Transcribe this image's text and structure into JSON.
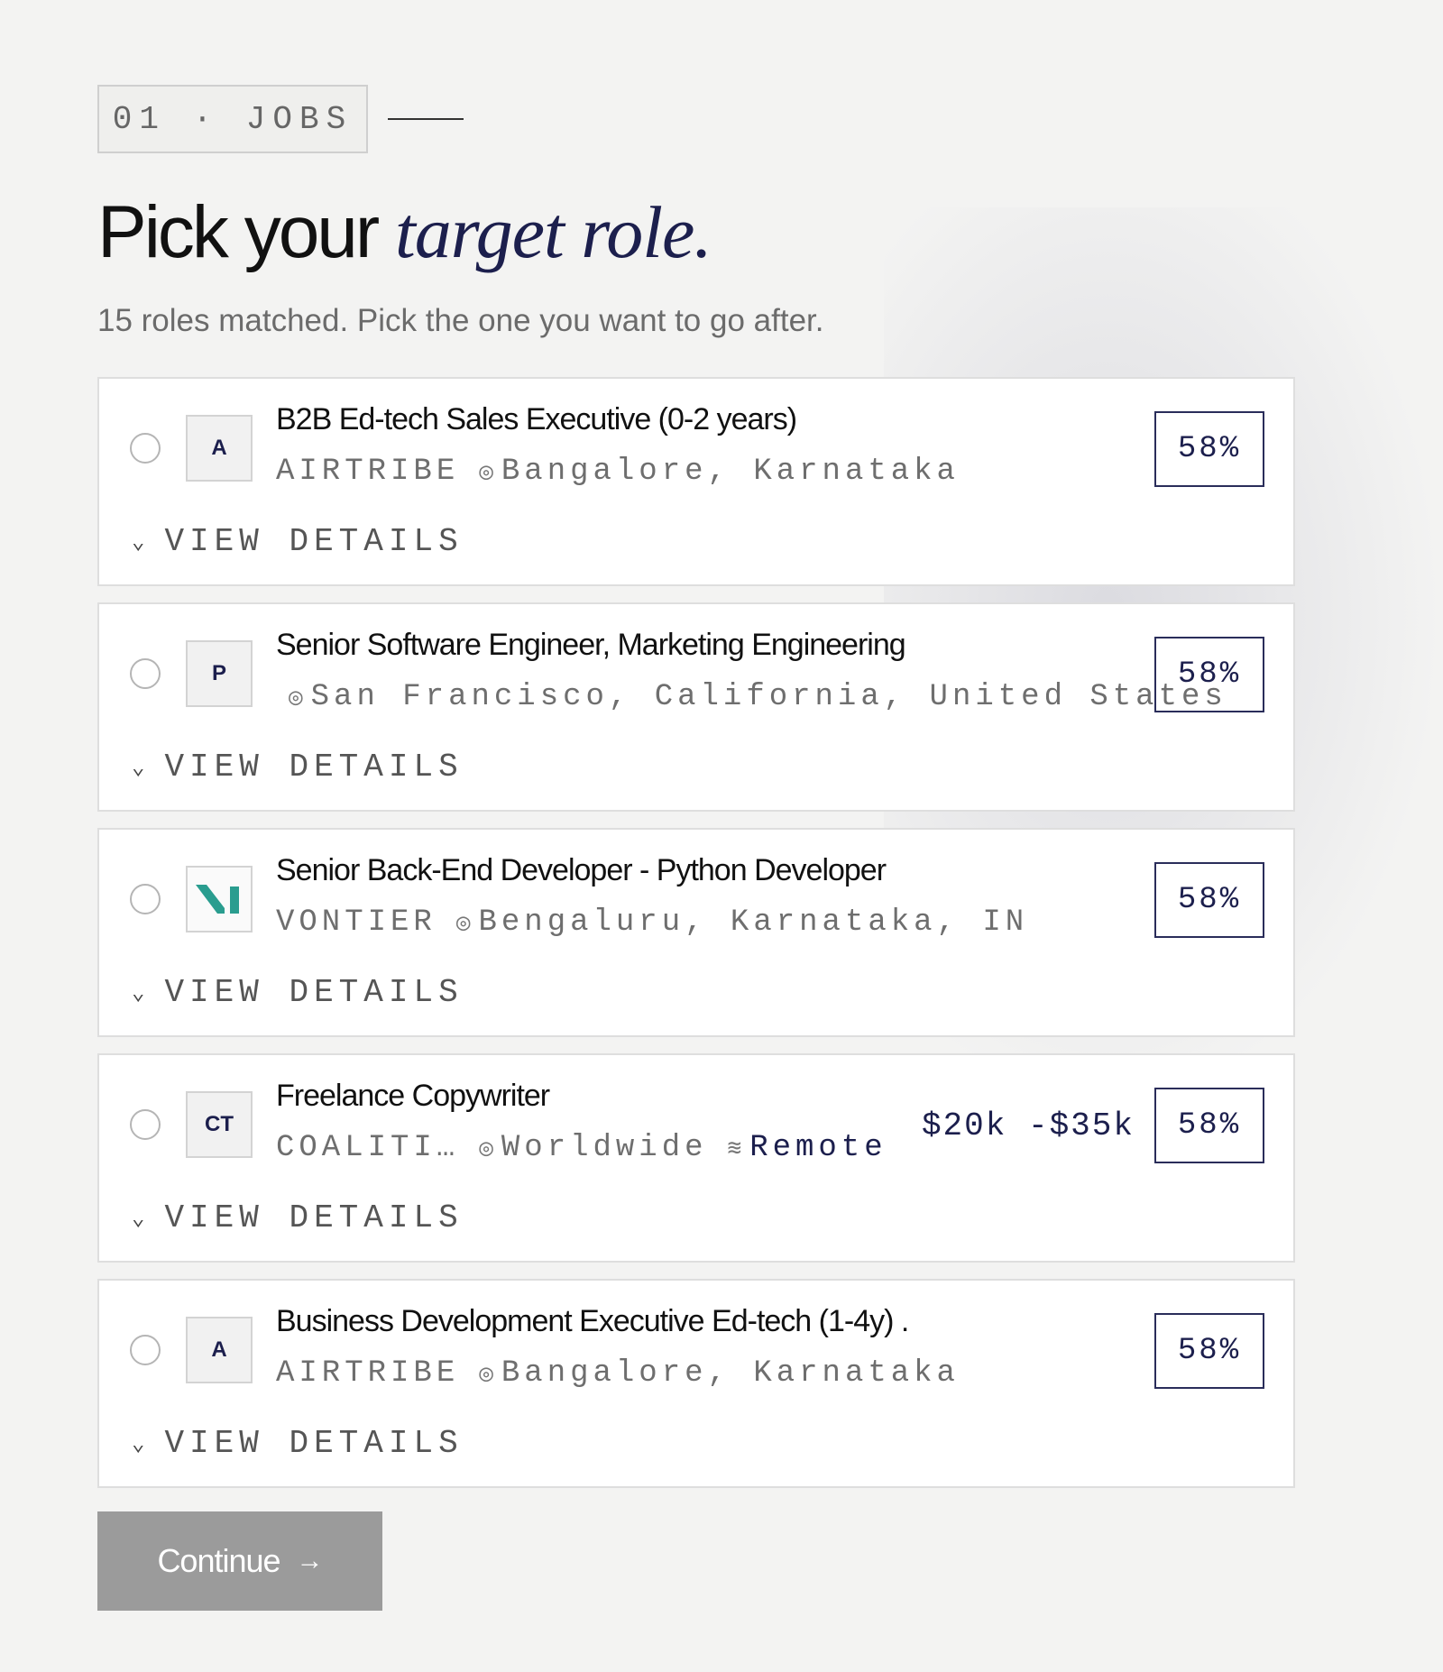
{
  "header": {
    "eyebrow": "01 · JOBS",
    "title_plain": "Pick your ",
    "title_accent": "target role.",
    "subtitle": "15 roles matched. Pick the one you want to go after."
  },
  "jobs": [
    {
      "logo": "A",
      "title": "B2B Ed-tech Sales Executive (0-2 years)",
      "company": "AIRTRIBE",
      "location": "Bangalore, Karnataka",
      "salary": "",
      "remote": "",
      "match": "58%",
      "details_label": "VIEW DETAILS"
    },
    {
      "logo": "P",
      "title": "Senior Software Engineer, Marketing Engineering",
      "company": "",
      "location": "San Francisco, California, United States",
      "salary": "",
      "remote": "",
      "match": "58%",
      "details_label": "VIEW DETAILS"
    },
    {
      "logo": "",
      "title": "Senior Back-End Developer - Python Developer",
      "company": "VONTIER",
      "location": "Bengaluru, Karnataka, IN",
      "salary": "",
      "remote": "",
      "match": "58%",
      "details_label": "VIEW DETAILS"
    },
    {
      "logo": "CT",
      "title": "Freelance Copywriter",
      "company": "COALITI…",
      "location": "Worldwide",
      "salary": "$20k -$35k",
      "remote": "Remote",
      "match": "58%",
      "details_label": "VIEW DETAILS"
    },
    {
      "logo": "A",
      "title": "Business Development Executive Ed-tech (1-4y) .",
      "company": "AIRTRIBE",
      "location": "Bangalore, Karnataka",
      "salary": "",
      "remote": "",
      "match": "58%",
      "details_label": "VIEW DETAILS"
    }
  ],
  "continue_label": "Continue",
  "colors": {
    "accent": "#1c1f4d",
    "vontier_logo": "#2a9d8f",
    "button_disabled": "#9b9b9b"
  },
  "icons": {
    "location": "location-pin-icon",
    "remote": "wifi-icon",
    "expand": "chevron-down-icon",
    "continue": "arrow-right-icon"
  }
}
